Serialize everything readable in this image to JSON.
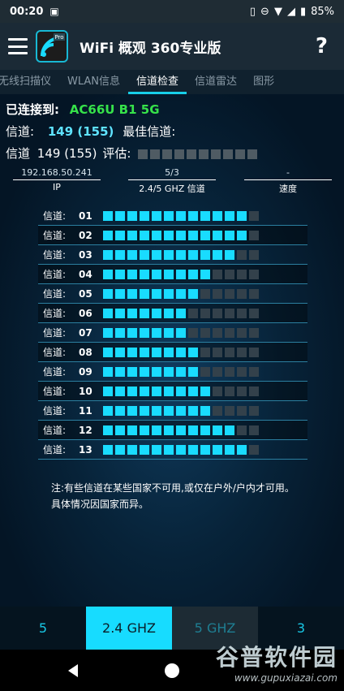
{
  "status_bar": {
    "time": "00:20",
    "battery": "85%"
  },
  "app_bar": {
    "title": "WiFi 概观 360专业版",
    "help_label": "?"
  },
  "tabs": [
    {
      "label": "无线扫描仪"
    },
    {
      "label": "WLAN信息"
    },
    {
      "label": "信道检查"
    },
    {
      "label": "信道雷达"
    },
    {
      "label": "图形"
    }
  ],
  "connection": {
    "connected_label": "已连接到:",
    "ssid": "AC66U B1 5G",
    "channel_label": "信道:",
    "channel_value": "149 (155)",
    "best_channel_label": "最佳信道:",
    "rating_prefix": "信道",
    "rating_value": "149 (155)",
    "rating_label": "评估:",
    "rating_score": 0,
    "rating_max": 10
  },
  "stats": {
    "ip_value": "192.168.50.241",
    "ip_label": "IP",
    "band_value": "5/3",
    "band_label": "2.4/5 GHZ 信道",
    "speed_value": "-",
    "speed_label": "速度"
  },
  "channel_label": "信道:",
  "channels": [
    {
      "num": "01",
      "level": 12
    },
    {
      "num": "02",
      "level": 12
    },
    {
      "num": "03",
      "level": 11
    },
    {
      "num": "04",
      "level": 9
    },
    {
      "num": "05",
      "level": 8
    },
    {
      "num": "06",
      "level": 7
    },
    {
      "num": "07",
      "level": 7
    },
    {
      "num": "08",
      "level": 8
    },
    {
      "num": "09",
      "level": 8
    },
    {
      "num": "10",
      "level": 9
    },
    {
      "num": "11",
      "level": 9
    },
    {
      "num": "12",
      "level": 11
    },
    {
      "num": "13",
      "level": 12
    }
  ],
  "channel_max": 13,
  "note": "注:有些信道在某些国家不可用,或仅在户外/户内才可用。具体情况因国家而异。",
  "bottom_tabs": [
    {
      "label": "5"
    },
    {
      "label": "2.4 GHZ"
    },
    {
      "label": "5 GHZ"
    },
    {
      "label": "3"
    }
  ],
  "watermark": {
    "line1": "谷普软件园",
    "line2": "www.gupuxiazai.com"
  }
}
